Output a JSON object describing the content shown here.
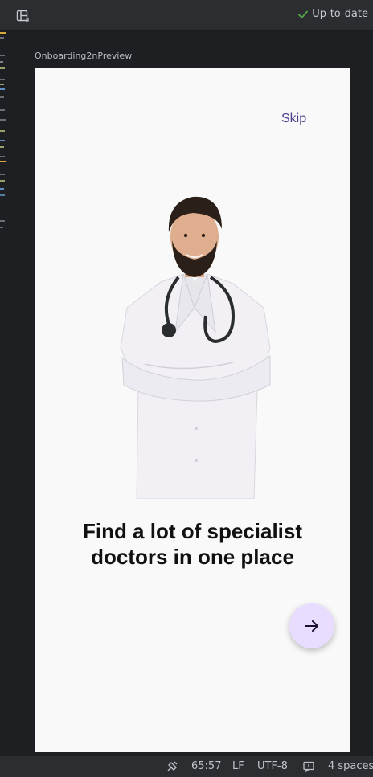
{
  "toolbar": {
    "layout_icon": "layout-panel-icon",
    "status_label": "Up-to-date",
    "status_icon": "check-icon",
    "status_color": "#57a64a"
  },
  "preview": {
    "label": "Onboarding2nPreview"
  },
  "onboarding": {
    "skip_label": "Skip",
    "image": "doctor-illustration",
    "headline_line1": "Find a lot of specialist",
    "headline_line2": "doctors in one place",
    "next_icon": "arrow-right-icon",
    "accent_color": "#4a3f8c",
    "fab_color": "#e8dcff"
  },
  "status_bar": {
    "cursor_position": "65:57",
    "line_ending": "LF",
    "encoding": "UTF-8",
    "indent": "4 spaces"
  }
}
